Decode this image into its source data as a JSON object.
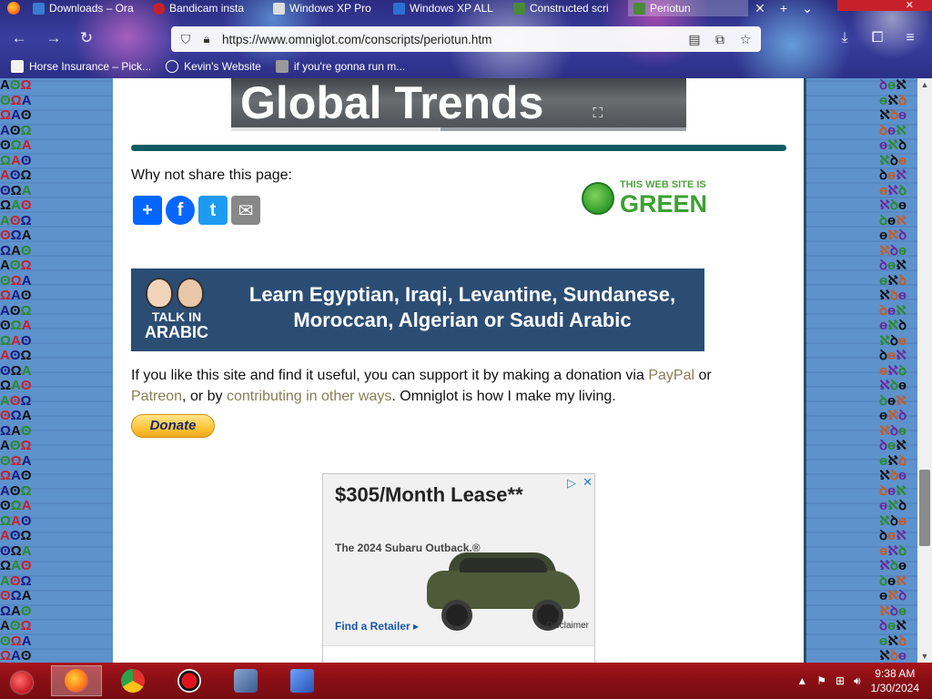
{
  "browser": {
    "tabs": [
      {
        "title": "Downloads – Ora",
        "fav_color": "#3a7bd5"
      },
      {
        "title": "Bandicam insta",
        "fav_color": "#c8202a"
      },
      {
        "title": "Windows XP Pro",
        "fav_color": "#dddddd"
      },
      {
        "title": "Windows XP ALL",
        "fav_color": "#2a6fd1"
      },
      {
        "title": "Constructed scri",
        "fav_color": "#4a8a3a"
      },
      {
        "title": "Periotun",
        "fav_color": "#4a8a3a"
      }
    ],
    "url": "https://www.omniglot.com/conscripts/periotun.htm",
    "bookmarks": [
      {
        "label": "Horse Insurance – Pick...",
        "icon_color": "#f3f3f3"
      },
      {
        "label": "Kevin's Website",
        "icon_color": "#ffffff"
      },
      {
        "label": "if you're gonna run m...",
        "icon_color": "#9a9a9a"
      }
    ]
  },
  "page": {
    "hero_title": "Global Trends",
    "hero_progress": 0.46,
    "share_label": "Why not share this page:",
    "share_buttons": [
      {
        "label": "+",
        "name": "share",
        "color": "#0166ff"
      },
      {
        "label": "f",
        "name": "facebook",
        "color": "#0866ff"
      },
      {
        "label": "t",
        "name": "twitter",
        "color": "#1d9bf0"
      },
      {
        "label": "✉",
        "name": "email",
        "color": "#888888"
      }
    ],
    "green_badge": {
      "line1": "THIS WEB SITE IS",
      "line2": "GREEN"
    },
    "arabic_banner": {
      "logo_line1": "TALK IN",
      "logo_line2": "ARABIC",
      "line1": "Learn Egyptian, Iraqi, Levantine, Sundanese,",
      "line2": "Moroccan, Algerian or Saudi Arabic"
    },
    "donate_text": {
      "part1": "If you like this site and find it useful, you can support it by making a donation via ",
      "paypal": "PayPal",
      "part2": " or ",
      "patreon": "Patreon",
      "part3": ", or by ",
      "contributing": "contributing in other ways",
      "part4": ". Omniglot is how I make my living."
    },
    "donate_button": "Donate",
    "ad": {
      "title": "$305/Month Lease**",
      "subtitle": "The 2024 Subaru Outback.®",
      "cta": "Find a Retailer ▸",
      "disclaimer": "Disclaimer"
    }
  },
  "taskbar": {
    "apps": [
      {
        "name": "firefox",
        "color": "#ff7a1a",
        "active": true
      },
      {
        "name": "chrome",
        "color": "#4a8ad8",
        "active": false
      },
      {
        "name": "bandicam",
        "color": "#e0141c",
        "active": false
      },
      {
        "name": "virtualbox",
        "color": "#5a7cb0",
        "active": false
      },
      {
        "name": "xp-installer",
        "color": "#3a6ac8",
        "active": false
      }
    ],
    "time": "9:38 AM",
    "date": "1/30/2024"
  }
}
